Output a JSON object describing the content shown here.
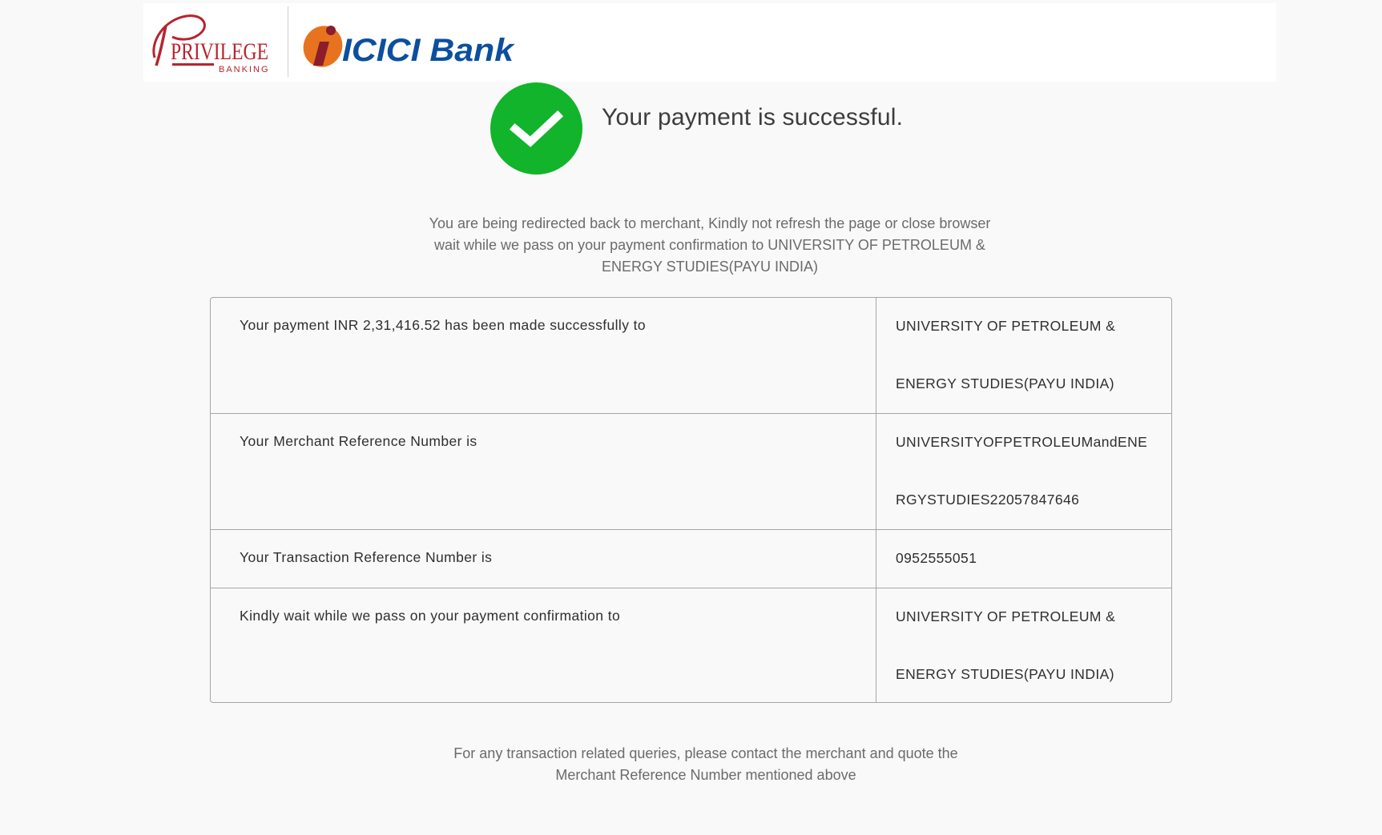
{
  "header": {
    "privilege_logo_text": "PRIVILEGE",
    "privilege_logo_subtext": "BANKING",
    "bank_logo_text": "ICICI Bank",
    "brand_red": "#b8232f",
    "brand_orange": "#e8731f",
    "brand_blue": "#0c4f9e"
  },
  "status": {
    "icon": "checkmark-circle-icon",
    "icon_color": "#11b42a",
    "title": "Your payment is successful."
  },
  "redirect_message": {
    "line1": "You are being redirected back to merchant, Kindly not refresh the page or close browser",
    "line2": "wait while we pass on your payment confirmation to UNIVERSITY OF PETROLEUM &",
    "line3": "ENERGY STUDIES(PAYU INDIA)"
  },
  "details": [
    {
      "label": "Your payment INR 2,31,416.52 has been made successfully to",
      "value_lines": [
        "UNIVERSITY OF PETROLEUM &",
        "ENERGY STUDIES(PAYU INDIA)"
      ]
    },
    {
      "label": "Your Merchant Reference Number is",
      "value_lines": [
        "UNIVERSITYOFPETROLEUMandENE",
        "RGYSTUDIES22057847646"
      ]
    },
    {
      "label": "Your Transaction Reference Number is",
      "value_lines": [
        "0952555051"
      ]
    },
    {
      "label": "Kindly wait while we pass on your payment confirmation to",
      "value_lines": [
        "UNIVERSITY OF PETROLEUM &",
        "ENERGY STUDIES(PAYU INDIA)"
      ]
    }
  ],
  "footer_message": {
    "line1": "For any transaction related queries, please contact the merchant and quote the",
    "line2": "Merchant Reference Number mentioned above"
  }
}
